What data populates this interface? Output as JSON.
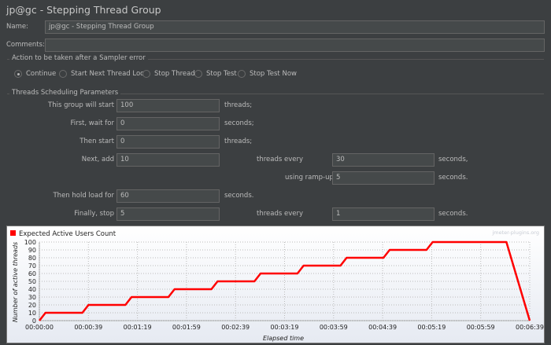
{
  "title": "jp@gc - Stepping Thread Group",
  "name_label": "Name:",
  "name_value": "jp@gc - Stepping Thread Group",
  "comments_label": "Comments:",
  "comments_value": "",
  "action_group": {
    "title": "Action to be taken after a Sampler error",
    "options": [
      {
        "label": "Continue",
        "selected": true
      },
      {
        "label": "Start Next Thread Loop",
        "selected": false
      },
      {
        "label": "Stop Thread",
        "selected": false
      },
      {
        "label": "Stop Test",
        "selected": false
      },
      {
        "label": "Stop Test Now",
        "selected": false
      }
    ]
  },
  "sched": {
    "title": "Threads Scheduling Parameters",
    "start_label": "This group will start",
    "start_value": "100",
    "start_unit": "threads;",
    "wait_label": "First, wait for",
    "wait_value": "0",
    "wait_unit": "seconds;",
    "then_label": "Then start",
    "then_value": "0",
    "then_unit": "threads;",
    "next_label": "Next, add",
    "next_value": "10",
    "next_mid": "threads every",
    "next_every": "30",
    "next_unit": "seconds,",
    "ramp_label": "using ramp-up",
    "ramp_value": "5",
    "ramp_unit": "seconds.",
    "hold_label": "Then hold load for",
    "hold_value": "60",
    "hold_unit": "seconds.",
    "stop_label": "Finally, stop",
    "stop_value": "5",
    "stop_mid": "threads every",
    "stop_every": "1",
    "stop_unit": "seconds."
  },
  "chart_data": {
    "type": "line",
    "legend": "Expected Active Users Count",
    "legend_placement": "top-left",
    "watermark": "jmeter-plugins.org",
    "xlabel": "Elapsed time",
    "ylabel": "Number of active threads",
    "xlim": [
      0,
      399
    ],
    "ylim": [
      0,
      100
    ],
    "xticks": [
      0,
      39.9,
      79.8,
      119.7,
      159.6,
      199.5,
      239.4,
      279.3,
      319.2,
      359.1,
      399
    ],
    "xtick_labels": [
      "00:00:00",
      "00:00:39",
      "00:01:19",
      "00:01:59",
      "00:02:39",
      "00:03:19",
      "00:03:59",
      "00:04:39",
      "00:05:19",
      "00:05:59",
      "00:06:39"
    ],
    "yticks": [
      0,
      10,
      20,
      30,
      40,
      50,
      60,
      70,
      80,
      90,
      100
    ],
    "series": [
      {
        "name": "Expected Active Users Count",
        "color": "#ff0000",
        "points": [
          [
            0,
            0
          ],
          [
            5,
            10
          ],
          [
            35,
            10
          ],
          [
            40,
            20
          ],
          [
            70,
            20
          ],
          [
            75,
            30
          ],
          [
            105,
            30
          ],
          [
            110,
            40
          ],
          [
            140,
            40
          ],
          [
            145,
            50
          ],
          [
            175,
            50
          ],
          [
            180,
            60
          ],
          [
            210,
            60
          ],
          [
            215,
            70
          ],
          [
            245,
            70
          ],
          [
            250,
            80
          ],
          [
            280,
            80
          ],
          [
            285,
            90
          ],
          [
            315,
            90
          ],
          [
            320,
            100
          ],
          [
            380,
            100
          ],
          [
            399,
            0
          ]
        ]
      }
    ]
  }
}
